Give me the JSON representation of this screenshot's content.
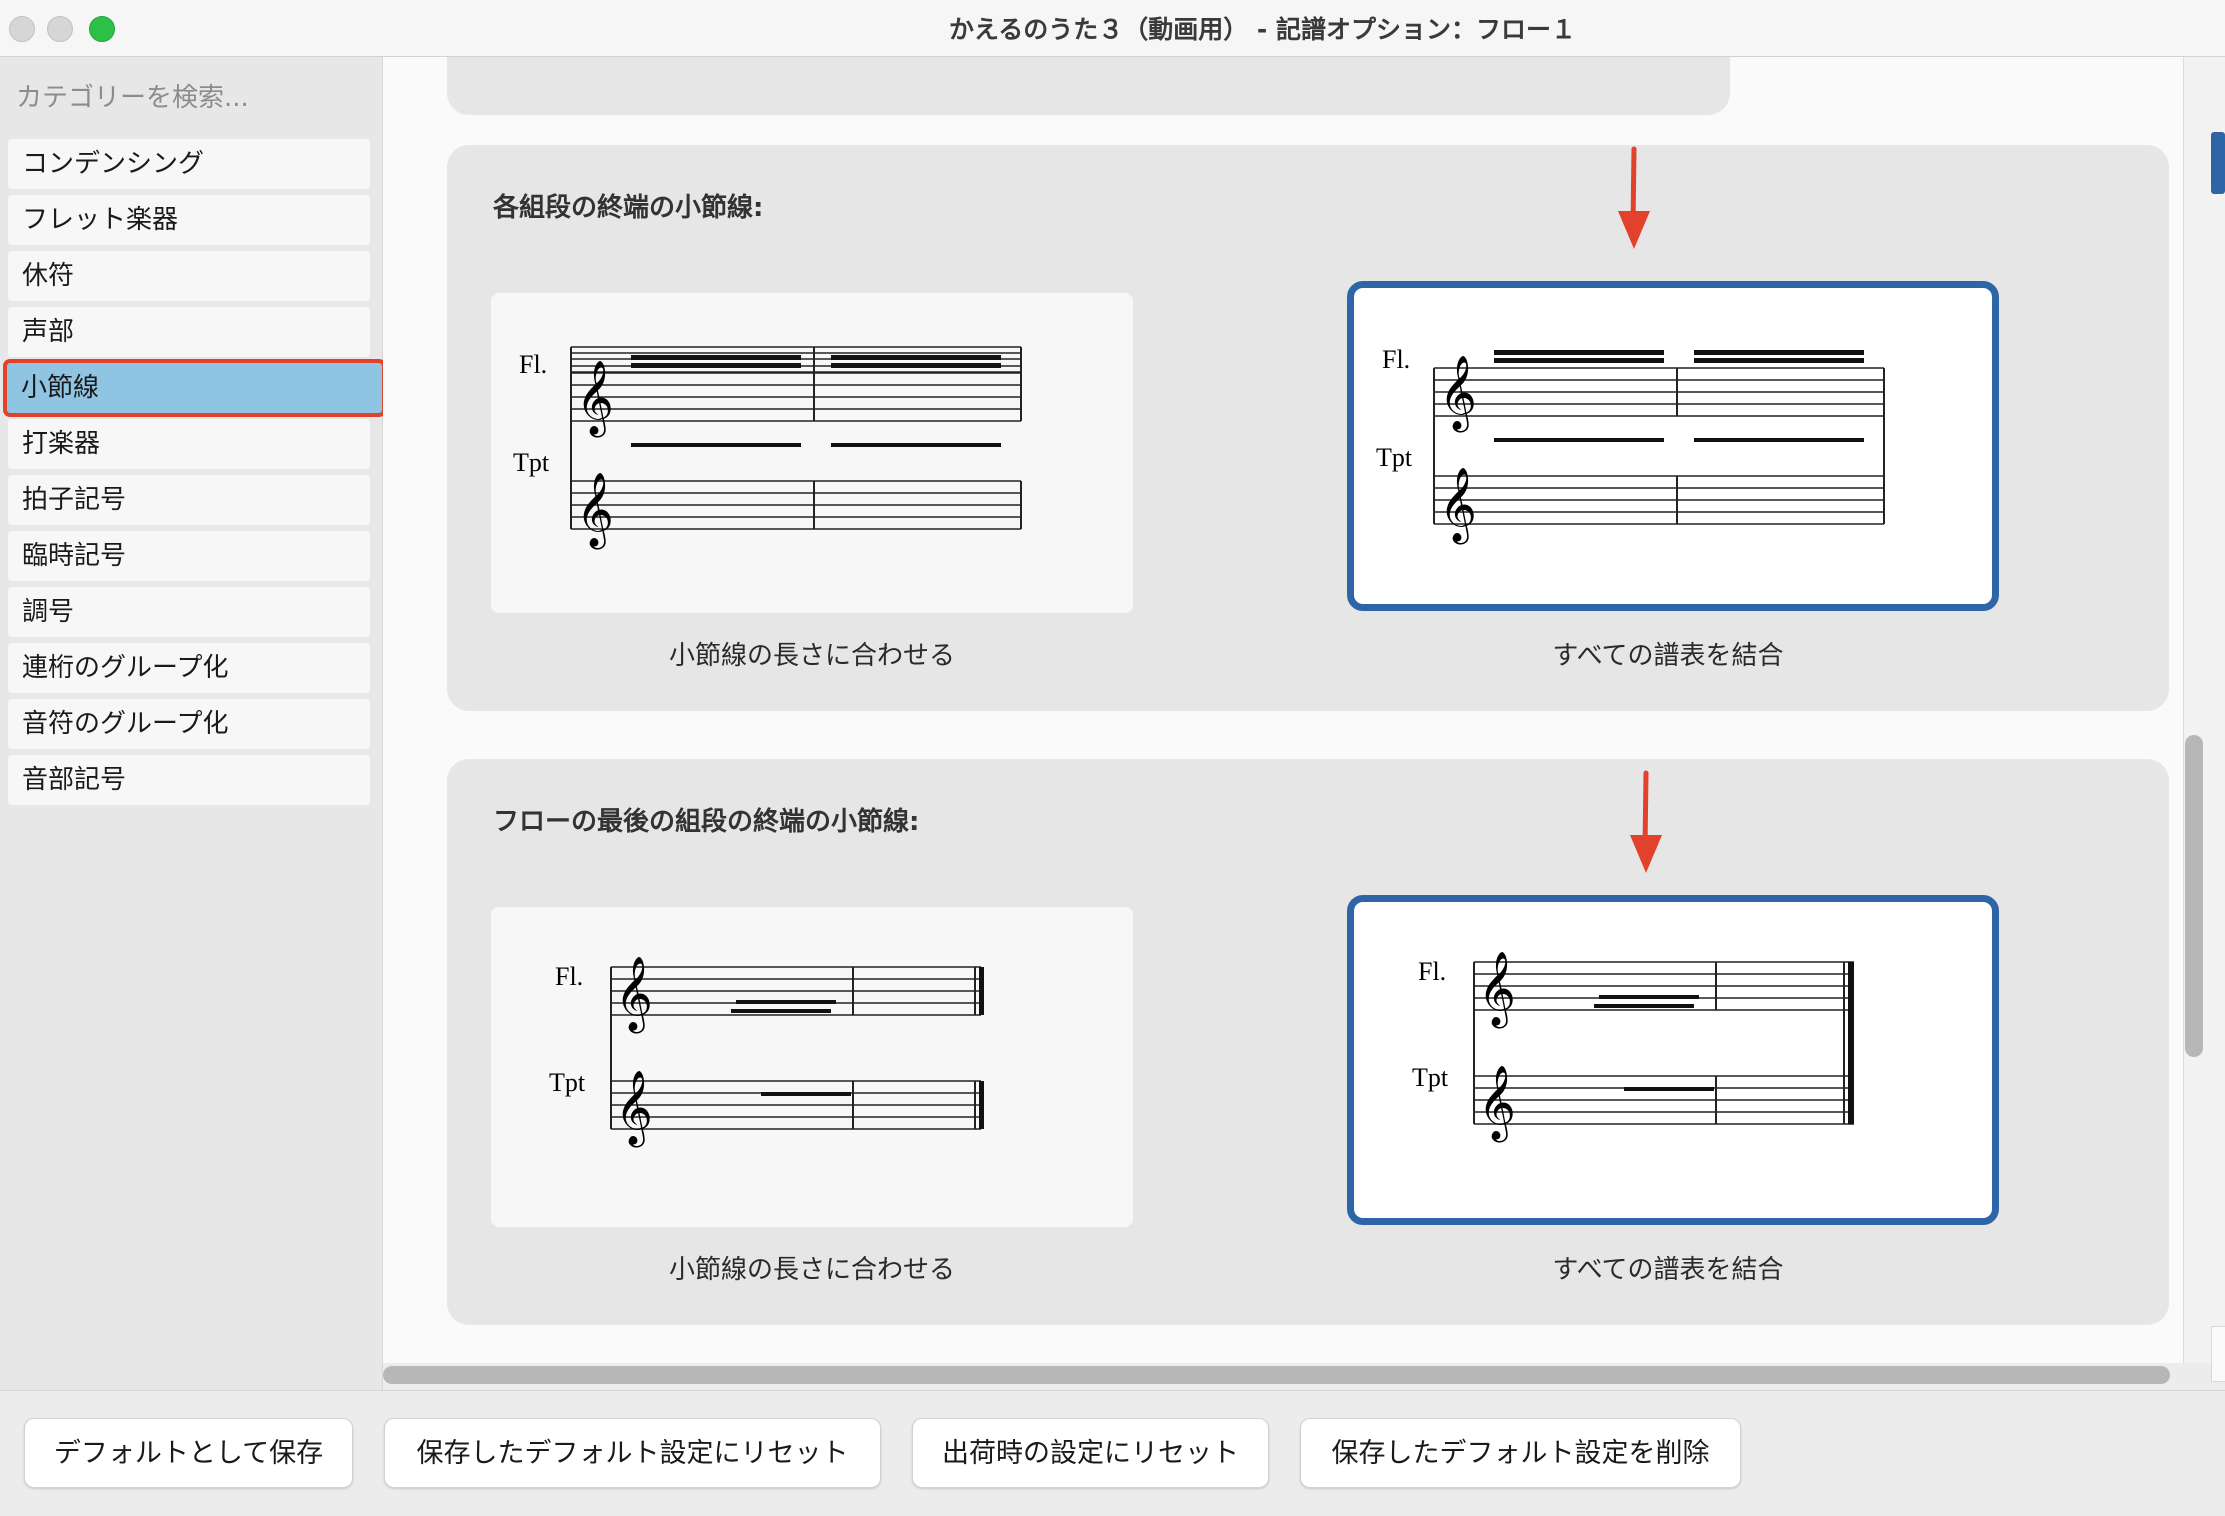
{
  "window": {
    "title": "かえるのうた３（動画用） - 記譜オプション：フロー１"
  },
  "sidebar": {
    "search_placeholder": "カテゴリーを検索...",
    "items": [
      {
        "label": "コンデンシング"
      },
      {
        "label": "フレット楽器"
      },
      {
        "label": "休符"
      },
      {
        "label": "声部"
      },
      {
        "label": "小節線",
        "selected": true
      },
      {
        "label": "打楽器"
      },
      {
        "label": "拍子記号"
      },
      {
        "label": "臨時記号"
      },
      {
        "label": "調号"
      },
      {
        "label": "連桁のグループ化"
      },
      {
        "label": "音符のグループ化"
      },
      {
        "label": "音部記号"
      }
    ]
  },
  "sections": [
    {
      "heading": "各組段の終端の小節線:",
      "options": [
        {
          "caption": "小節線の長さに合わせる",
          "selected": false
        },
        {
          "caption": "すべての譜表を結合",
          "selected": true
        }
      ],
      "staff_labels": [
        "Fl.",
        "Tpt"
      ]
    },
    {
      "heading": "フローの最後の組段の終端の小節線:",
      "options": [
        {
          "caption": "小節線の長さに合わせる",
          "selected": false
        },
        {
          "caption": "すべての譜表を結合",
          "selected": true
        }
      ],
      "staff_labels": [
        "Fl.",
        "Tpt"
      ]
    }
  ],
  "buttons": {
    "save_default": "デフォルトとして保存",
    "reset_saved": "保存したデフォルト設定にリセット",
    "reset_factory": "出荷時の設定にリセット",
    "delete_saved": "保存したデフォルト設定を削除"
  },
  "colors": {
    "selected_border": "#2e65a6",
    "selected_item_bg": "#8fc5e2",
    "highlight_outline": "#e2412c",
    "arrow": "#e2412c",
    "traffic_green": "#2dc048"
  },
  "icons": {
    "arrow": "down-arrow-icon",
    "treble_clef": "treble-clef-icon"
  }
}
